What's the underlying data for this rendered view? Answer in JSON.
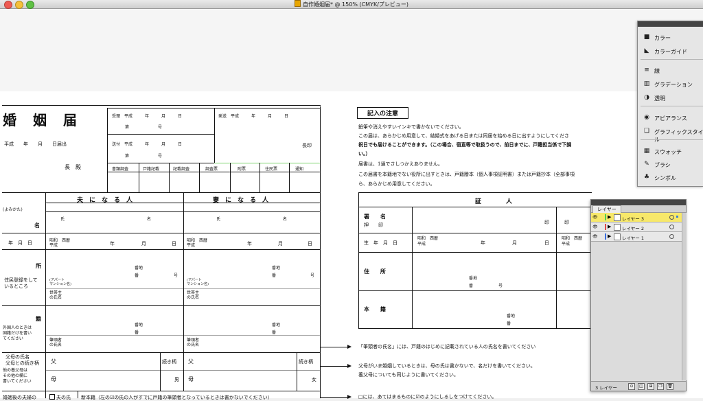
{
  "window": {
    "title": "自作婚姻届* @ 150% (CMYK/プレビュー)"
  },
  "tools_panel": {
    "items": [
      {
        "label": "カラー",
        "icon": "color-icon"
      },
      {
        "label": "カラーガイド",
        "icon": "color-guide-icon"
      },
      {
        "label": "線",
        "icon": "stroke-icon"
      },
      {
        "label": "グラデーション",
        "icon": "gradient-icon"
      },
      {
        "label": "透明",
        "icon": "transparency-icon"
      },
      {
        "label": "アピアランス",
        "icon": "appearance-icon"
      },
      {
        "label": "グラフィックスタイル",
        "icon": "graphic-style-icon"
      },
      {
        "label": "スウォッチ",
        "icon": "swatches-icon"
      },
      {
        "label": "ブラシ",
        "icon": "brush-icon"
      },
      {
        "label": "シンボル",
        "icon": "symbol-icon"
      }
    ]
  },
  "layers_panel": {
    "tab_label": "レイヤー",
    "layers": [
      {
        "name": "レイヤー 3",
        "color": "#4fd14f",
        "selected": true
      },
      {
        "name": "レイヤー 2",
        "color": "#e04a4a",
        "selected": false
      },
      {
        "name": "レイヤー 1",
        "color": "#3a6fe0",
        "selected": false
      }
    ],
    "footer_count": "3 レイヤー"
  },
  "form": {
    "title": "婚　姻　届",
    "date_line": "平成　　年　　月　　日届出",
    "addressee": "長　殿",
    "reception": {
      "received": "受理　平成　　　年　　　月　　　日",
      "sent": "送付　平成　　　年　　　月　　　日",
      "number": "第　　　　　　　号",
      "dispatch": "発送　平成　　　年　　　月　　　日",
      "seal": "長印"
    },
    "check_columns": [
      "書類調査",
      "戸籍記載",
      "記載調査",
      "調査票",
      "附票",
      "住民票",
      "通知"
    ],
    "husband_header": "夫　に　な　る　人",
    "wife_header": "妻　に　な　る　人",
    "furigana": "(よみかた)",
    "name_label": "名",
    "birth_label": "年　月　日",
    "surname": "氏",
    "givenname": "名",
    "era_options": "昭和　西暦\n平成",
    "year": "年",
    "month": "月",
    "day": "日",
    "address_label": "所",
    "address_note": "住民登録をして\nいるところ",
    "banchi": "番地",
    "ban": "番",
    "go": "号",
    "apartment": "(アパート\nマンション名)",
    "householder": "世帯主\nの氏名",
    "domicile_label": "籍",
    "domicile_note": "外国人のときは\n国籍だけを書い\nてください",
    "head_name": "筆頭者\nの氏名",
    "parents_label": "父母の氏名\n父母との続き柄",
    "parents_note": "他の養父母は\nその他の欄に\n書いてください",
    "father": "父",
    "mother": "母",
    "relation": "続き柄",
    "son": "男",
    "daughter": "女",
    "after_marriage": "婚姻後の夫婦の",
    "husband_surname_opt": "夫の氏",
    "new_domicile": "新本籍（左の☑の氏の人がすでに戸籍の筆頭者となっているときは書かないでください）"
  },
  "notes": {
    "title": "記入の注意",
    "lines": [
      "鉛筆や消えやすいインキで書かないでください。",
      "この届は、あらかじめ用意して、結婚式をあげる日または同居を始める日に出すようにしてくださ",
      "祝日でも届けることができます。（この場合、宿直等で取扱うので、前日までに、戸籍担当係で下調",
      "い。）",
      "届書は、1通でさしつかえありません。",
      "この届書を本籍地でない役所に出すときは、戸籍謄本（個人事項証明書）または戸籍抄本（全部事項",
      "ら、あらかじめ用意してください。"
    ],
    "arrow_notes": [
      "「筆頭者の氏名」には、戸籍のはじめに記載されている人の氏名を書いてください",
      "父母がいま婚姻しているときは、母の氏は書かないで、名だけを書いてください。",
      "養父母についても同じように書いてください。",
      "□には、あてはまるものに☑のようにしるしをつけてください。"
    ]
  },
  "witness": {
    "header": "証　　　　人",
    "signature": "署　　名",
    "seal_note": "押　　印",
    "seal_mark": "印",
    "birth": "生　年　月　日",
    "era_options": "昭和　西暦\n平成",
    "year": "年",
    "month": "月",
    "day": "日",
    "address": "住　　所",
    "banchi": "番地",
    "ban": "番",
    "go": "号",
    "domicile": "本　　籍"
  }
}
